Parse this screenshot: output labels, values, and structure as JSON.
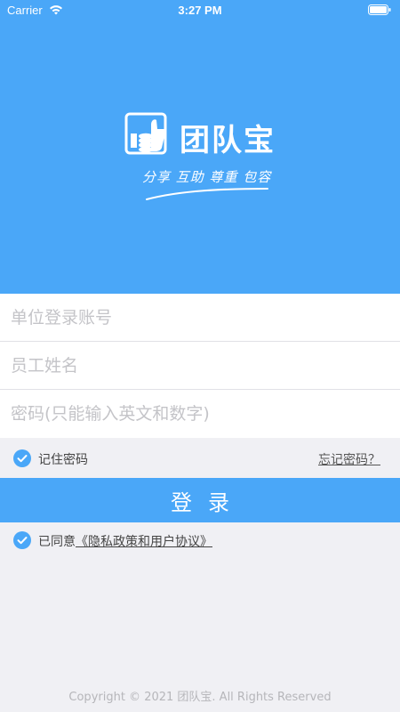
{
  "status_bar": {
    "carrier": "Carrier",
    "time": "3:27 PM"
  },
  "brand": {
    "app_name": "团队宝",
    "slogan": "分享 互助 尊重 包容"
  },
  "form": {
    "account_placeholder": "单位登录账号",
    "name_placeholder": "员工姓名",
    "password_placeholder": "密码(只能输入英文和数字)"
  },
  "options": {
    "remember_label": "记住密码",
    "forgot_label": "忘记密码？",
    "remember_checked": true
  },
  "login": {
    "button_label": "登录"
  },
  "agreement": {
    "prefix": "已同意",
    "link": "《隐私政策和用户协议》",
    "checked": true
  },
  "footer": {
    "copyright": "Copyright © 2021 团队宝. All Rights Reserved"
  },
  "colors": {
    "primary": "#4aa7f8",
    "background": "#f0f0f4"
  }
}
